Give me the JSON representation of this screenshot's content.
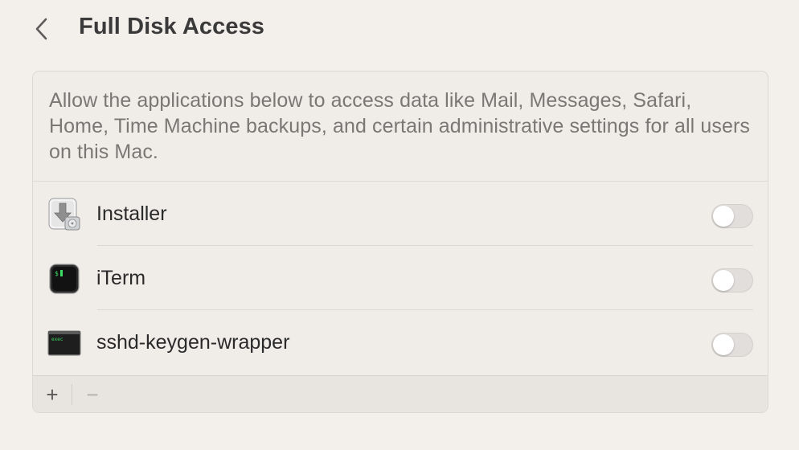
{
  "header": {
    "back_icon": "chevron-left-icon",
    "title": "Full Disk Access"
  },
  "panel": {
    "description": "Allow the applications below to access data like Mail, Messages, Safari, Home, Time Machine backups, and certain administrative settings for all users on this Mac.",
    "apps": [
      {
        "name": "Installer",
        "icon": "installer-icon",
        "enabled": false
      },
      {
        "name": "iTerm",
        "icon": "iterm-icon",
        "enabled": false
      },
      {
        "name": "sshd-keygen-wrapper",
        "icon": "exec-icon",
        "enabled": false
      }
    ],
    "footer": {
      "add_label": "+",
      "remove_label": "−"
    }
  },
  "colors": {
    "background": "#f3efeb",
    "panel": "#f0ece8",
    "toggle_off": "#e2dedb"
  }
}
